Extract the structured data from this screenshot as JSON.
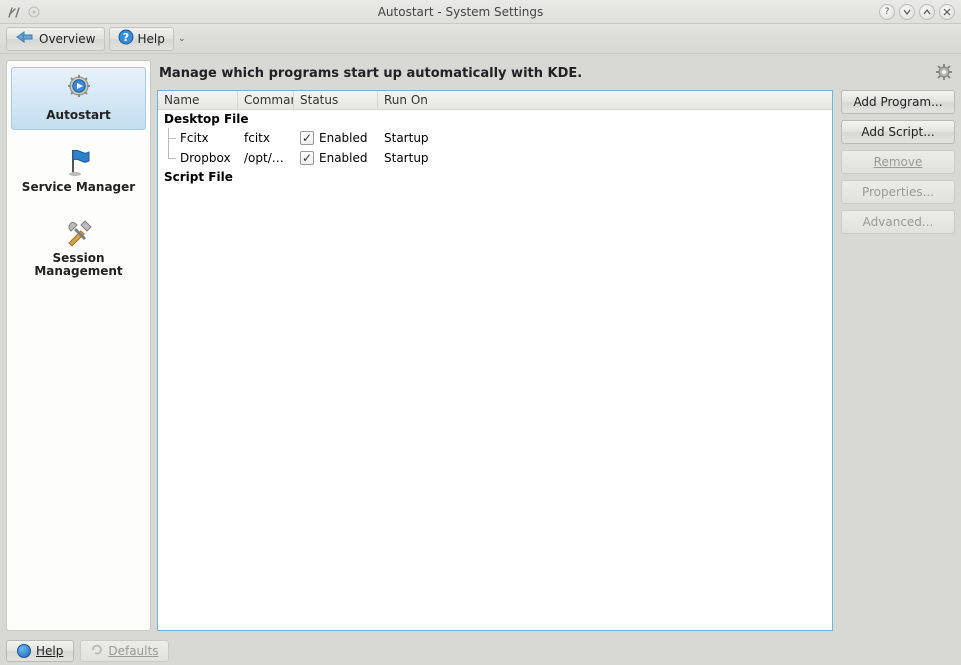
{
  "window": {
    "title": "Autostart - System Settings"
  },
  "toolbar": {
    "overview": "Overview",
    "help": "Help"
  },
  "sidebar": {
    "items": [
      {
        "label": "Autostart",
        "icon": "play-gear-icon",
        "selected": true
      },
      {
        "label": "Service Manager",
        "icon": "flag-icon",
        "selected": false
      },
      {
        "label": "Session Management",
        "icon": "tools-icon",
        "selected": false
      }
    ]
  },
  "heading": "Manage which programs start up automatically with KDE.",
  "columns": {
    "name": "Name",
    "command": "Command",
    "status": "Status",
    "runon": "Run On"
  },
  "groups": {
    "desktop": {
      "label": "Desktop File",
      "items": [
        {
          "name": "Fcitx",
          "command": "fcitx",
          "enabled": true,
          "status": "Enabled",
          "runon": "Startup"
        },
        {
          "name": "Dropbox",
          "command": "/opt/…",
          "enabled": true,
          "status": "Enabled",
          "runon": "Startup"
        }
      ]
    },
    "script": {
      "label": "Script File",
      "items": []
    }
  },
  "buttons": {
    "add_program": "Add Program...",
    "add_script": "Add Script...",
    "remove": "Remove",
    "properties": "Properties...",
    "advanced": "Advanced..."
  },
  "footer": {
    "help": "Help",
    "defaults": "Defaults"
  }
}
